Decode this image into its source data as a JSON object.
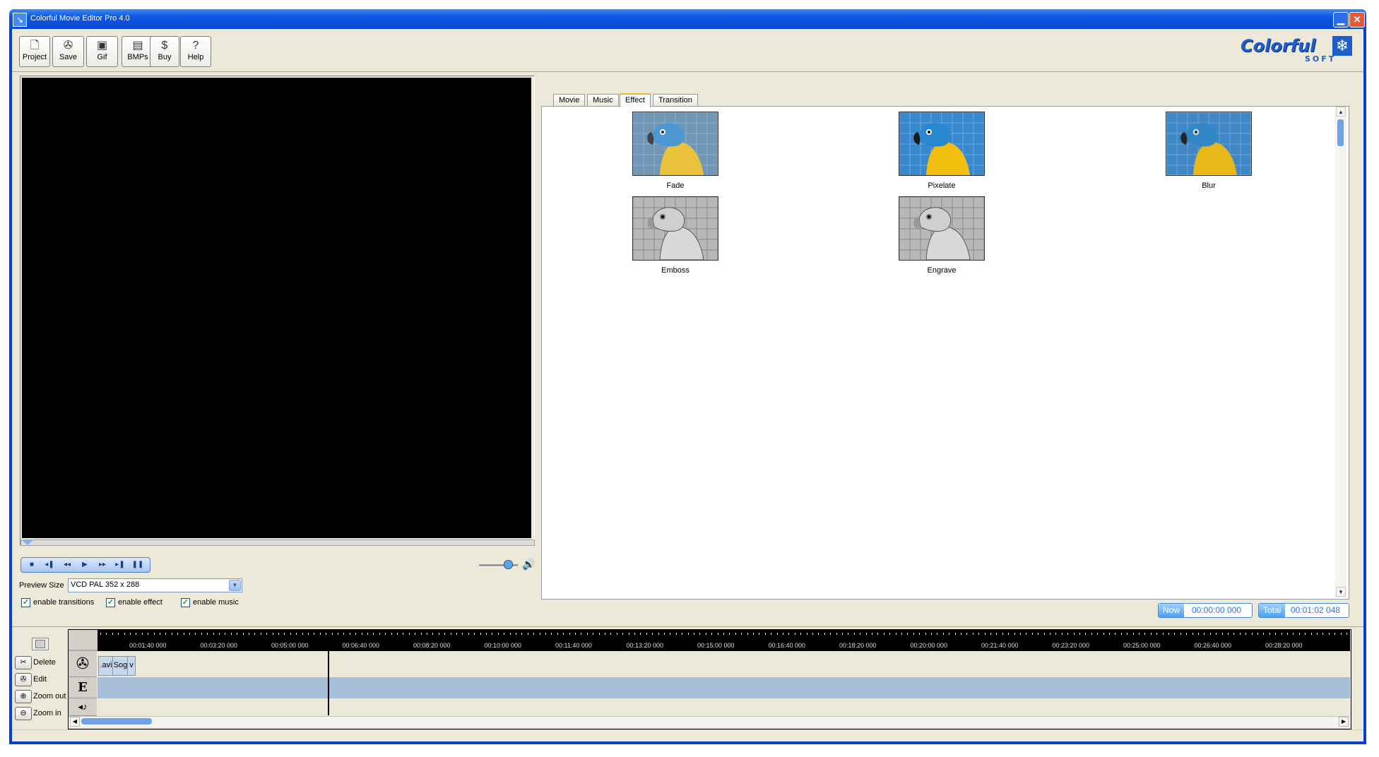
{
  "window": {
    "title": "Colorful Movie Editor Pro 4.0",
    "minimize_glyph": "▁",
    "close_glyph": "✕"
  },
  "toolbar": [
    {
      "label": "Project",
      "icon": "project-icon",
      "glyph": "🗋"
    },
    {
      "label": "Save",
      "icon": "film-reel-icon",
      "glyph": "✇"
    },
    {
      "label": "Gif",
      "icon": "gif-icon",
      "glyph": "▣"
    },
    {
      "label": "BMPs",
      "icon": "bmps-icon",
      "glyph": "▤"
    },
    {
      "label": "Buy",
      "icon": "buy-icon",
      "glyph": "$"
    },
    {
      "label": "Help",
      "icon": "help-icon",
      "glyph": "?"
    }
  ],
  "logo": {
    "text": "Colorful",
    "sub": "SOFT"
  },
  "player": {
    "buttons": [
      {
        "name": "stop",
        "glyph": "■"
      },
      {
        "name": "step-back",
        "glyph": "◂❚"
      },
      {
        "name": "rewind",
        "glyph": "◂◂"
      },
      {
        "name": "play",
        "glyph": "▶"
      },
      {
        "name": "fast-forward",
        "glyph": "▸▸"
      },
      {
        "name": "step-forward",
        "glyph": "▸❚"
      },
      {
        "name": "pause",
        "glyph": "❚❚"
      }
    ],
    "volume_icon": "🔊",
    "volume_level": 0.7
  },
  "preview_size": {
    "label": "Preview Size",
    "value": "VCD PAL 352 x 288",
    "arrow": "▼"
  },
  "checkboxes": [
    {
      "label": "enable transitions",
      "checked": true
    },
    {
      "label": "enable effect",
      "checked": true
    },
    {
      "label": "enable music",
      "checked": true
    }
  ],
  "check_glyph": "✓",
  "tabs": [
    {
      "label": "Movie",
      "active": false
    },
    {
      "label": "Music",
      "active": false
    },
    {
      "label": "Effect",
      "active": true
    },
    {
      "label": "Transition",
      "active": false
    }
  ],
  "effects": [
    {
      "label": "Fade"
    },
    {
      "label": "Pixelate"
    },
    {
      "label": "Blur"
    },
    {
      "label": "Emboss"
    },
    {
      "label": "Engrave"
    }
  ],
  "scroll": {
    "up": "▲",
    "down": "▼",
    "left": "◀",
    "right": "▶"
  },
  "time": {
    "now_label": "Now",
    "now_value": "00:00:00 000",
    "total_label": "Total",
    "total_value": "00:01:02 048"
  },
  "side_buttons": [
    {
      "label": "Delete",
      "glyph": "✂",
      "icon": "scissors-icon"
    },
    {
      "label": "Edit",
      "glyph": "✇",
      "icon": "film-reel-icon"
    },
    {
      "label": "Zoom out",
      "glyph": "⊕",
      "icon": "zoom-out-icon"
    },
    {
      "label": "Zoom in",
      "glyph": "⊖",
      "icon": "zoom-in-icon"
    }
  ],
  "timeline": {
    "ticks": [
      "00:01:40 000",
      "00:03:20 000",
      "00:05:00 000",
      "00:06:40 000",
      "00:08:20 000",
      "00:10:00 000",
      "00:11:40 000",
      "00:13:20 000",
      "00:15:00 000",
      "00:16:40 000",
      "00:18:20 000",
      "00:20:00 000",
      "00:21:40 000",
      "00:23:20 000",
      "00:25:00 000",
      "00:26:40 000",
      "00:28:20 000"
    ],
    "track_icons": {
      "movie": "✇",
      "effect": "E",
      "music": "◂♪"
    },
    "clips": [
      ".avi",
      "Sog",
      "v"
    ]
  }
}
